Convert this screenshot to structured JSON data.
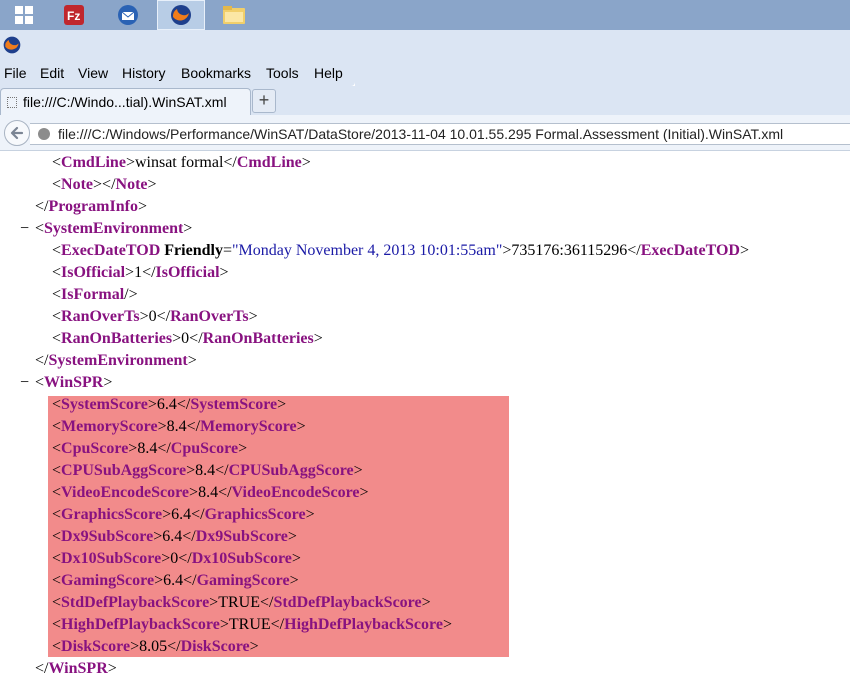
{
  "taskbar": {
    "icons": [
      "windows-start-icon",
      "filezilla-icon",
      "thunderbird-icon",
      "firefox-icon",
      "folder-icon"
    ]
  },
  "menu": {
    "file": "File",
    "edit": "Edit",
    "view": "View",
    "history": "History",
    "bookmarks": "Bookmarks",
    "tools": "Tools",
    "help": "Help"
  },
  "tab": {
    "title": "file:///C:/Windo...tial).WinSAT.xml",
    "new_tab": "+"
  },
  "urlbar": {
    "url": "file:///C:/Windows/Performance/WinSAT/DataStore/2013-11-04 10.01.55.295 Formal.Assessment (Initial).WinSAT.xml"
  },
  "xml": {
    "collapse_symbol": "−",
    "lines": [
      {
        "open": "CmdLine",
        "text": "winsat formal",
        "close": "CmdLine"
      },
      {
        "open": "Note",
        "text": "",
        "close": "Note"
      },
      {
        "close": "ProgramInfo"
      },
      {
        "open": "SystemEnvironment"
      },
      {
        "open": "ExecDateTOD",
        "attr": "Friendly",
        "attr_value": "\"Monday November 4, 2013 10:01:55am\"",
        "text": "735176:36115296",
        "close": "ExecDateTOD"
      },
      {
        "open": "IsOfficial",
        "text": "1",
        "close": "IsOfficial"
      },
      {
        "selfclose": "IsFormal"
      },
      {
        "open": "RanOverTs",
        "text": "0",
        "close": "RanOverTs"
      },
      {
        "open": "RanOnBatteries",
        "text": "0",
        "close": "RanOnBatteries"
      },
      {
        "close": "SystemEnvironment"
      },
      {
        "open": "WinSPR"
      },
      {
        "open": "SystemScore",
        "text": "6.4",
        "close": "SystemScore"
      },
      {
        "open": "MemoryScore",
        "text": "8.4",
        "close": "MemoryScore"
      },
      {
        "open": "CpuScore",
        "text": "8.4",
        "close": "CpuScore"
      },
      {
        "open": "CPUSubAggScore",
        "text": "8.4",
        "close": "CPUSubAggScore"
      },
      {
        "open": "VideoEncodeScore",
        "text": "8.4",
        "close": "VideoEncodeScore"
      },
      {
        "open": "GraphicsScore",
        "text": "6.4",
        "close": "GraphicsScore"
      },
      {
        "open": "Dx9SubScore",
        "text": "6.4",
        "close": "Dx9SubScore"
      },
      {
        "open": "Dx10SubScore",
        "text": "0",
        "close": "Dx10SubScore"
      },
      {
        "open": "GamingScore",
        "text": "6.4",
        "close": "GamingScore"
      },
      {
        "open": "StdDefPlaybackScore",
        "text": "TRUE",
        "close": "StdDefPlaybackScore"
      },
      {
        "open": "HighDefPlaybackScore",
        "text": "TRUE",
        "close": "HighDefPlaybackScore"
      },
      {
        "open": "DiskScore",
        "text": "8.05",
        "close": "DiskScore"
      },
      {
        "close": "WinSPR"
      }
    ]
  },
  "colors": {
    "tag": "#881280",
    "attr_value": "#1a1aa6",
    "highlight": "#f28b8b"
  }
}
